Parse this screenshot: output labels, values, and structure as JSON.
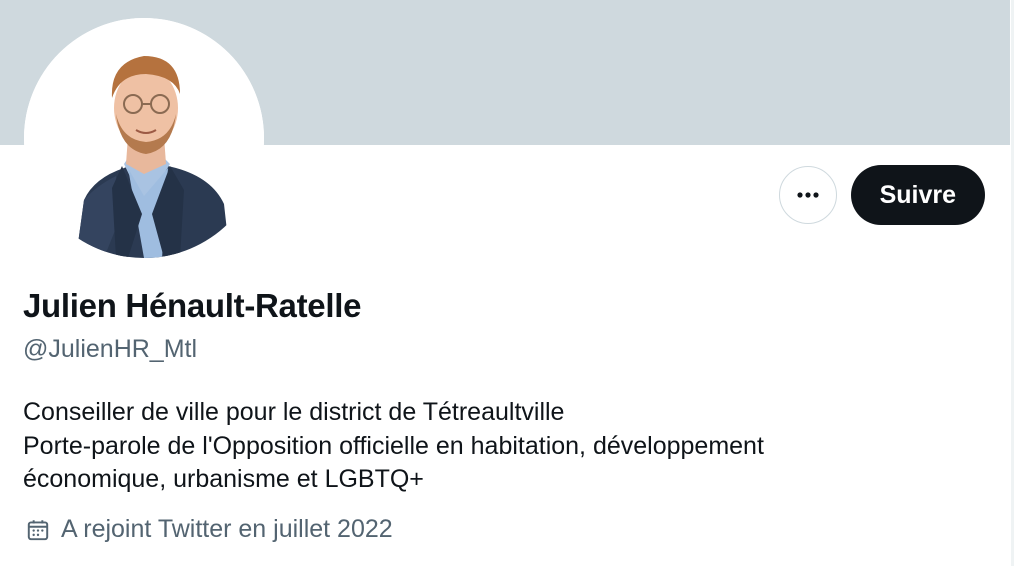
{
  "header": {
    "banner_color": "#cfd9de"
  },
  "profile": {
    "avatar_icon": "profile-photo",
    "display_name": "Julien Hénault-Ratelle",
    "handle": "@JulienHR_Mtl",
    "bio_lines": [
      "Conseiller de ville pour le district de Tétreaultville",
      "Porte-parole de l'Opposition officielle en habitation, développement",
      "économique, urbanisme et LGBTQ+"
    ],
    "joined_icon": "calendar-icon",
    "joined_text": "A rejoint Twitter en juillet 2022"
  },
  "actions": {
    "more_icon": "more-dots-icon",
    "follow_label": "Suivre"
  },
  "colors": {
    "text_primary": "#0f1419",
    "text_secondary": "#536471",
    "button_dark": "#0f1419",
    "border": "#cfd9de"
  }
}
